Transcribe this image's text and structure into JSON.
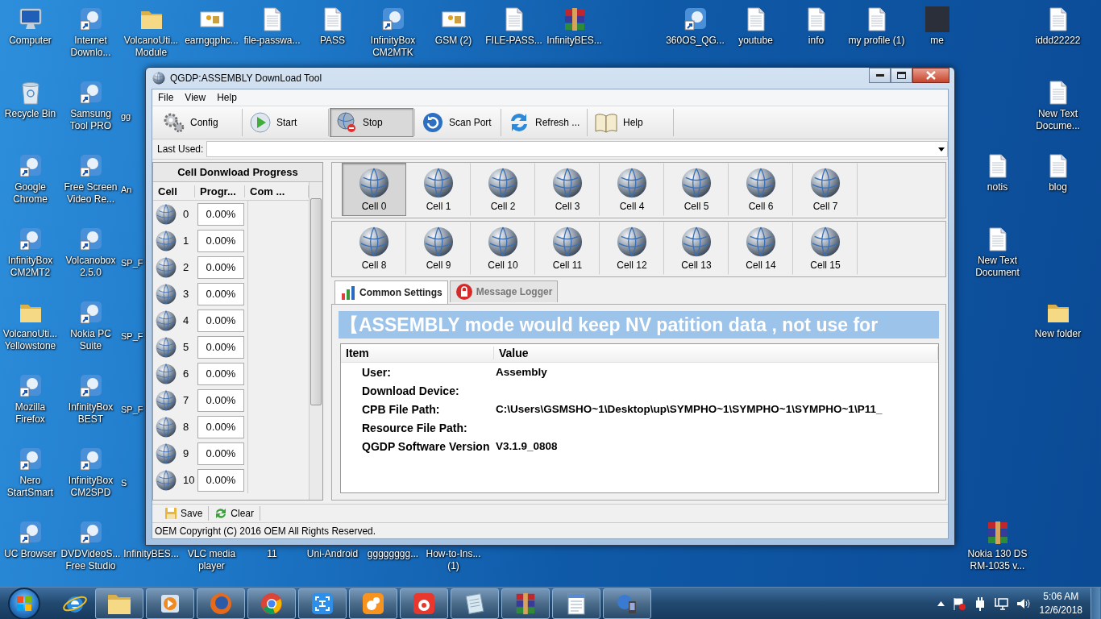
{
  "desktop_icons": [
    {
      "label": "Computer",
      "kind": "computer"
    },
    {
      "label": "Internet Downlo...",
      "kind": "app"
    },
    {
      "label": "VolcanoUti... Module",
      "kind": "folder"
    },
    {
      "label": "earngqphc...",
      "kind": "image"
    },
    {
      "label": "file-passwa...",
      "kind": "document"
    },
    {
      "label": "PASS",
      "kind": "document"
    },
    {
      "label": "InfinityBox CM2MTK",
      "kind": "app"
    },
    {
      "label": "GSM (2)",
      "kind": "image"
    },
    {
      "label": "FILE-PASS...",
      "kind": "document"
    },
    {
      "label": "InfinityBES...",
      "kind": "archive"
    },
    {
      "label": "360OS_QG...",
      "kind": "app"
    },
    {
      "label": "youtube",
      "kind": "document"
    },
    {
      "label": "info",
      "kind": "document"
    },
    {
      "label": "my profile (1)",
      "kind": "document"
    },
    {
      "label": "me",
      "kind": "photo"
    },
    {
      "label": "iddd22222",
      "kind": "document"
    },
    {
      "label": "Recycle Bin",
      "kind": "bin"
    },
    {
      "label": "Samsung Tool PRO",
      "kind": "app"
    },
    {
      "label": "gg",
      "kind": "partial"
    },
    {
      "label": "New Text Docume...",
      "kind": "document"
    },
    {
      "label": "Google Chrome",
      "kind": "app"
    },
    {
      "label": "Free Screen Video Re...",
      "kind": "app"
    },
    {
      "label": "An",
      "kind": "partial"
    },
    {
      "label": "notis",
      "kind": "document"
    },
    {
      "label": "blog",
      "kind": "document"
    },
    {
      "label": "InfinityBox CM2MT2",
      "kind": "app"
    },
    {
      "label": "Volcanobox 2.5.0",
      "kind": "app"
    },
    {
      "label": "SP_F",
      "kind": "partial"
    },
    {
      "label": "New Text Document",
      "kind": "document"
    },
    {
      "label": "VolcanoUti... Yellowstone",
      "kind": "folder"
    },
    {
      "label": "Nokia PC Suite",
      "kind": "app"
    },
    {
      "label": "SP_F",
      "kind": "partial"
    },
    {
      "label": "New folder",
      "kind": "folder"
    },
    {
      "label": "Mozilla Firefox",
      "kind": "app"
    },
    {
      "label": "InfinityBox BEST",
      "kind": "app"
    },
    {
      "label": "SP_F",
      "kind": "partial"
    },
    {
      "label": "Nero StartSmart",
      "kind": "app"
    },
    {
      "label": "InfinityBox CM2SPD",
      "kind": "app"
    },
    {
      "label": "S",
      "kind": "partial"
    },
    {
      "label": "UC Browser",
      "kind": "app"
    },
    {
      "label": "DVDVideoS... Free Studio",
      "kind": "app"
    },
    {
      "label": "InfinityBES...",
      "kind": "hidden"
    },
    {
      "label": "VLC media player",
      "kind": "hidden"
    },
    {
      "label": "11",
      "kind": "hidden"
    },
    {
      "label": "Uni-Android",
      "kind": "hidden"
    },
    {
      "label": "gggggggg...",
      "kind": "hidden"
    },
    {
      "label": "How-to-Ins... (1)",
      "kind": "hidden"
    },
    {
      "label": "Nokia 130 DS RM-1035 v...",
      "kind": "archive"
    }
  ],
  "window": {
    "title": "QGDP:ASSEMBLY  DownLoad Tool",
    "menu": [
      "File",
      "View",
      "Help"
    ],
    "toolbar": [
      {
        "label": "Config",
        "selected": false
      },
      {
        "label": "Start",
        "selected": false
      },
      {
        "label": "Stop",
        "selected": true
      },
      {
        "label": "Scan Port",
        "selected": false
      },
      {
        "label": "Refresh ...",
        "selected": false
      },
      {
        "label": "Help",
        "selected": false
      }
    ],
    "last_used": {
      "label": "Last Used:"
    },
    "progress_panel": {
      "title": "Cell Donwload Progress",
      "columns": [
        "Cell",
        "Progr...",
        "Com ..."
      ],
      "rows": [
        {
          "cell": "0",
          "progress": "0.00%"
        },
        {
          "cell": "1",
          "progress": "0.00%"
        },
        {
          "cell": "2",
          "progress": "0.00%"
        },
        {
          "cell": "3",
          "progress": "0.00%"
        },
        {
          "cell": "4",
          "progress": "0.00%"
        },
        {
          "cell": "5",
          "progress": "0.00%"
        },
        {
          "cell": "6",
          "progress": "0.00%"
        },
        {
          "cell": "7",
          "progress": "0.00%"
        },
        {
          "cell": "8",
          "progress": "0.00%"
        },
        {
          "cell": "9",
          "progress": "0.00%"
        },
        {
          "cell": "10",
          "progress": "0.00%"
        }
      ]
    },
    "cells": [
      {
        "label": "Cell 0",
        "selected": true
      },
      {
        "label": "Cell 1",
        "selected": false
      },
      {
        "label": "Cell 2",
        "selected": false
      },
      {
        "label": "Cell 3",
        "selected": false
      },
      {
        "label": "Cell 4",
        "selected": false
      },
      {
        "label": "Cell 5",
        "selected": false
      },
      {
        "label": "Cell 6",
        "selected": false
      },
      {
        "label": "Cell 7",
        "selected": false
      },
      {
        "label": "Cell 8",
        "selected": false
      },
      {
        "label": "Cell 9",
        "selected": false
      },
      {
        "label": "Cell 10",
        "selected": false
      },
      {
        "label": "Cell 11",
        "selected": false
      },
      {
        "label": "Cell 12",
        "selected": false
      },
      {
        "label": "Cell 13",
        "selected": false
      },
      {
        "label": "Cell 14",
        "selected": false
      },
      {
        "label": "Cell 15",
        "selected": false
      }
    ],
    "tabs": [
      {
        "label": "Common Settings",
        "selected": true
      },
      {
        "label": "Message Logger",
        "selected": false
      }
    ],
    "banner": "【ASSEMBLY mode would keep NV patition data , not use for",
    "settings": {
      "columns": [
        "Item",
        "Value"
      ],
      "rows": [
        {
          "item": "User:",
          "value": "Assembly"
        },
        {
          "item": "Download Device:"
        },
        {
          "item": "CPB File Path:",
          "value": "C:\\Users\\GSMSHO~1\\Desktop\\up\\SYMPHO~1\\SYMPHO~1\\SYMPHO~1\\P11_"
        },
        {
          "item": "Resource File Path:"
        },
        {
          "item": "QGDP Software Version",
          "value": "V3.1.9_0808"
        }
      ]
    },
    "bottom_buttons": [
      "Save",
      "Clear"
    ],
    "status": "OEM Copyright (C) 2016 OEM All Rights Reserved."
  },
  "taskbar": {
    "time": "5:06 AM",
    "date": "12/6/2018"
  }
}
